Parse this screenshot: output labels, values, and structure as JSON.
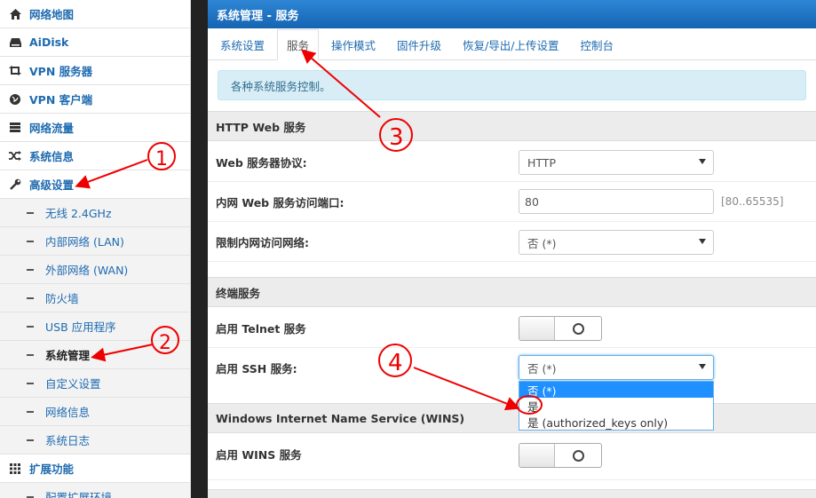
{
  "sidebar": {
    "items": [
      {
        "label": "网络地图",
        "icon": "home-icon"
      },
      {
        "label": "AiDisk",
        "icon": "hdd-icon"
      },
      {
        "label": "VPN 服务器",
        "icon": "retweet-icon"
      },
      {
        "label": "VPN 客户端",
        "icon": "globe-icon"
      },
      {
        "label": "网络流量",
        "icon": "tasks-icon"
      },
      {
        "label": "系统信息",
        "icon": "random-icon"
      },
      {
        "label": "高级设置",
        "icon": "wrench-icon"
      }
    ],
    "subitems": [
      {
        "label": "无线 2.4GHz"
      },
      {
        "label": "内部网络 (LAN)"
      },
      {
        "label": "外部网络 (WAN)"
      },
      {
        "label": "防火墙"
      },
      {
        "label": "USB 应用程序"
      },
      {
        "label": "系统管理"
      },
      {
        "label": "自定义设置"
      },
      {
        "label": "网络信息"
      },
      {
        "label": "系统日志"
      }
    ],
    "ext": {
      "label": "扩展功能",
      "icon": "th-icon"
    },
    "ext_sub": {
      "label": "配置扩展环境"
    }
  },
  "header": {
    "title": "系统管理 - 服务"
  },
  "tabs": [
    {
      "label": "系统设置"
    },
    {
      "label": "服务"
    },
    {
      "label": "操作模式"
    },
    {
      "label": "固件升级"
    },
    {
      "label": "恢复/导出/上传设置"
    },
    {
      "label": "控制台"
    }
  ],
  "info": "各种系统服务控制。",
  "http": {
    "section": "HTTP Web 服务",
    "protocol_label": "Web 服务器协议:",
    "protocol_value": "HTTP",
    "port_label": "内网 Web 服务访问端口:",
    "port_value": "80",
    "port_range": "[80..65535]",
    "restrict_label": "限制内网访问网络:",
    "restrict_value": "否 (*)"
  },
  "terminal": {
    "section": "终端服务",
    "telnet_label": "启用 Telnet 服务",
    "ssh_label": "启用 SSH 服务:",
    "ssh_value": "否 (*)",
    "ssh_options": [
      "否 (*)",
      "是",
      "是 (authorized_keys only)"
    ]
  },
  "wins": {
    "section": "Windows Internet Name Service (WINS)",
    "enable_label": "启用 WINS 服务"
  },
  "annotations": [
    "1",
    "2",
    "3",
    "4"
  ],
  "colors": {
    "accent": "#1e6bb0",
    "title_bar": "#1a70c0",
    "annotation": "#e00000"
  }
}
